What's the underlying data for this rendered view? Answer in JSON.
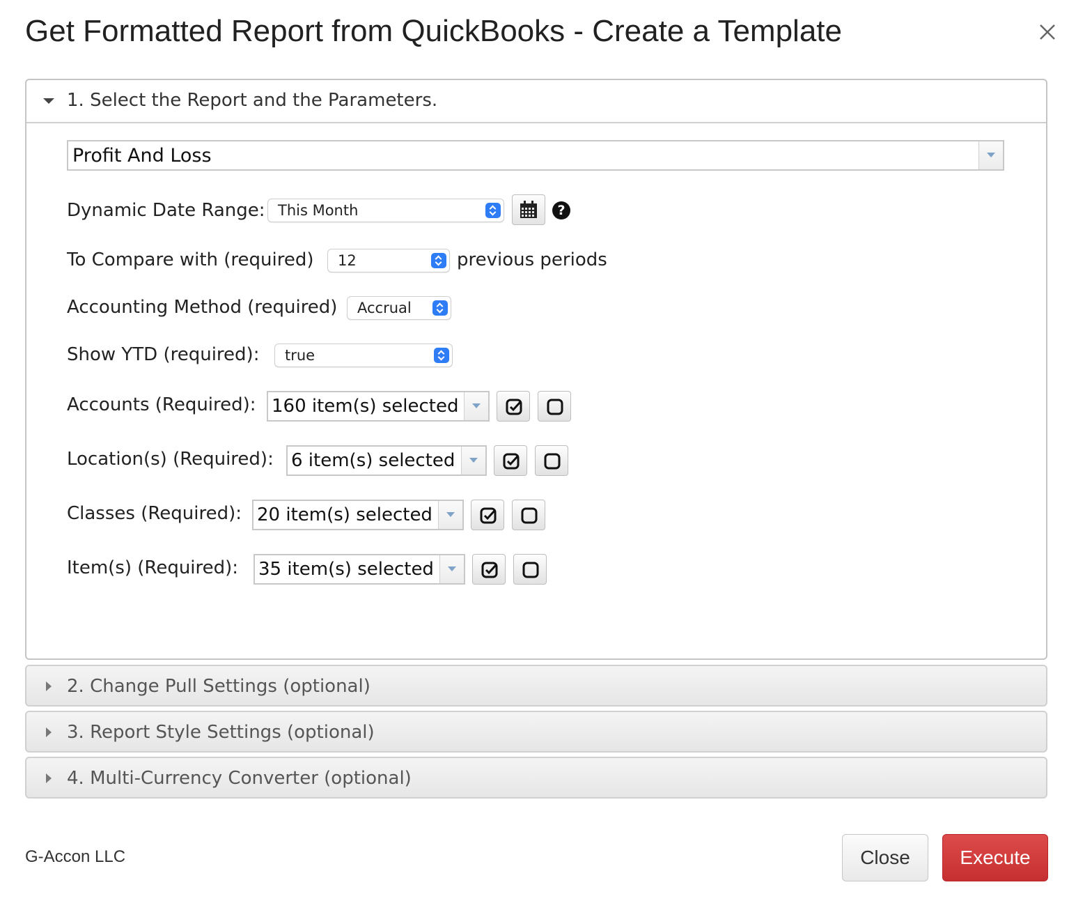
{
  "dialog": {
    "title": "Get Formatted Report from QuickBooks - Create a Template",
    "close_icon": "close-icon"
  },
  "sections": [
    {
      "label": "1. Select the Report and the Parameters.",
      "expanded": true
    },
    {
      "label": "2. Change Pull Settings (optional)",
      "expanded": false
    },
    {
      "label": "3. Report Style Settings (optional)",
      "expanded": false
    },
    {
      "label": "4. Multi-Currency Converter (optional)",
      "expanded": false
    }
  ],
  "report": {
    "selected": "Profit And Loss"
  },
  "params": {
    "date_range_label": "Dynamic Date Range:",
    "date_range_value": "This Month",
    "compare_label": "To Compare with (required)",
    "compare_value": "12",
    "compare_suffix": "previous periods",
    "method_label": "Accounting Method (required)",
    "method_value": "Accrual",
    "ytd_label": "Show YTD (required):",
    "ytd_value": "true",
    "accounts_label": "Accounts (Required):",
    "accounts_value": "160 item(s) selected",
    "locations_label": "Location(s) (Required):",
    "locations_value": "6 item(s) selected",
    "classes_label": "Classes (Required):",
    "classes_value": "20 item(s) selected",
    "items_label": "Item(s) (Required):",
    "items_value": "35 item(s) selected"
  },
  "footer": {
    "company": "G-Accon LLC",
    "close_label": "Close",
    "execute_label": "Execute"
  },
  "colors": {
    "execute": "#c9302c",
    "select_accent": "#2f7df6"
  }
}
